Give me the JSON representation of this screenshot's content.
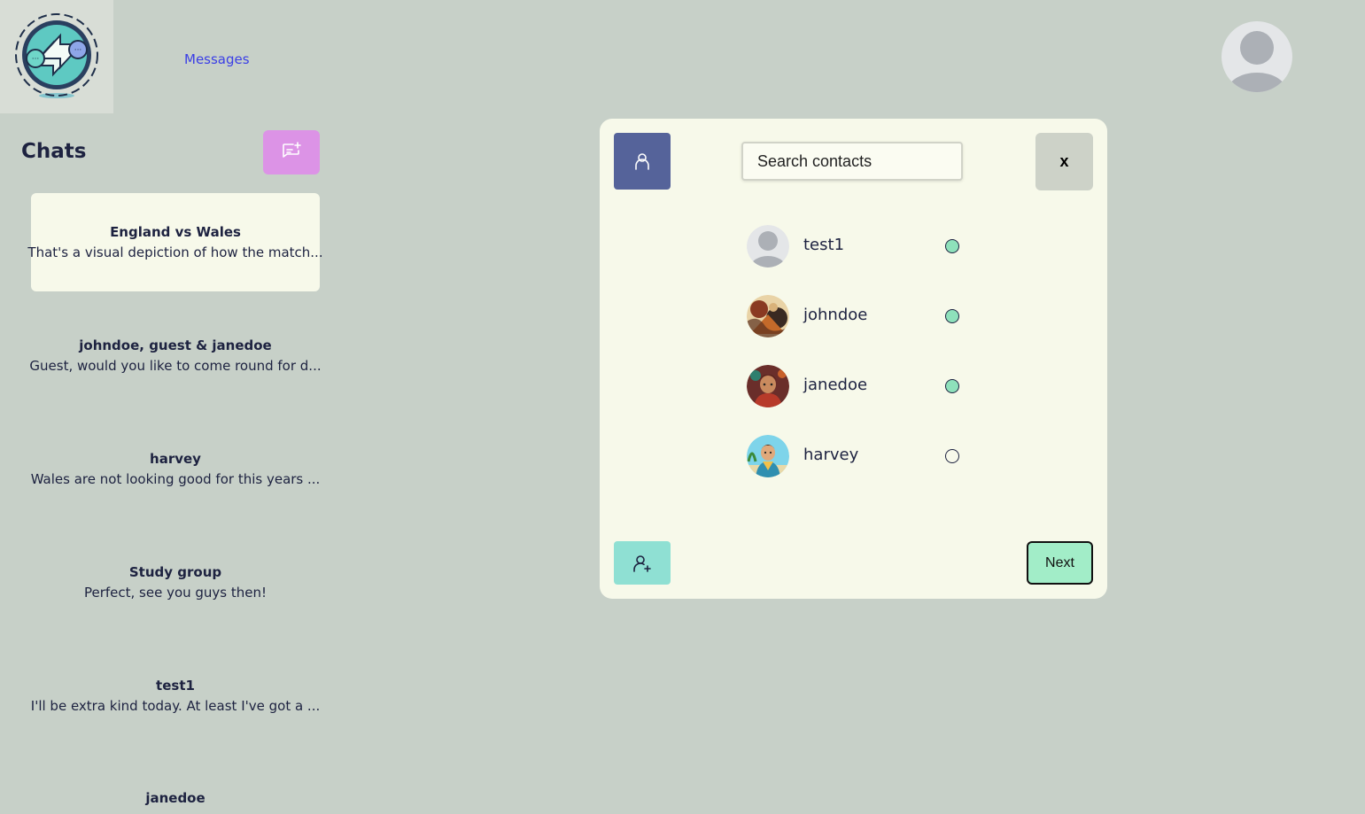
{
  "header": {
    "logo_icon": "chat-exchange-logo-icon",
    "nav_messages": "Messages",
    "profile_icon": "user-avatar-icon"
  },
  "sidebar": {
    "title": "Chats",
    "new_chat_icon": "message-plus-icon",
    "chats": [
      {
        "name": "England vs Wales",
        "preview": "That's a visual depiction of how the match...",
        "active": true
      },
      {
        "name": "johndoe, guest & janedoe",
        "preview": "Guest, would you like to come round for d...",
        "active": false
      },
      {
        "name": "harvey",
        "preview": "Wales are not looking good for this years ...",
        "active": false
      },
      {
        "name": "Study group",
        "preview": "Perfect, see you guys then!",
        "active": false
      },
      {
        "name": "test1",
        "preview": "I'll be extra kind today. At least I've got a ...",
        "active": false
      },
      {
        "name": "janedoe",
        "preview": "",
        "active": false
      }
    ]
  },
  "modal": {
    "contacts_icon": "user-icon",
    "search_placeholder": "Search contacts",
    "close_label": "x",
    "contacts": [
      {
        "name": "test1",
        "selected": true,
        "avatar": "default-avatar-icon"
      },
      {
        "name": "johndoe",
        "selected": true,
        "avatar": "photo-avatar"
      },
      {
        "name": "janedoe",
        "selected": true,
        "avatar": "photo-avatar"
      },
      {
        "name": "harvey",
        "selected": false,
        "avatar": "photo-avatar"
      }
    ],
    "add_contact_icon": "user-plus-icon",
    "next_label": "Next"
  },
  "colors": {
    "background": "#c7d0c8",
    "panel": "#f7f9ea",
    "new_chat_button": "#dc93e6",
    "contacts_button": "#55639a",
    "add_contact_button": "#8fe0d3",
    "next_button": "#a2edc8",
    "selected_radio": "#8ee1bb",
    "link": "#3a3ee6"
  }
}
